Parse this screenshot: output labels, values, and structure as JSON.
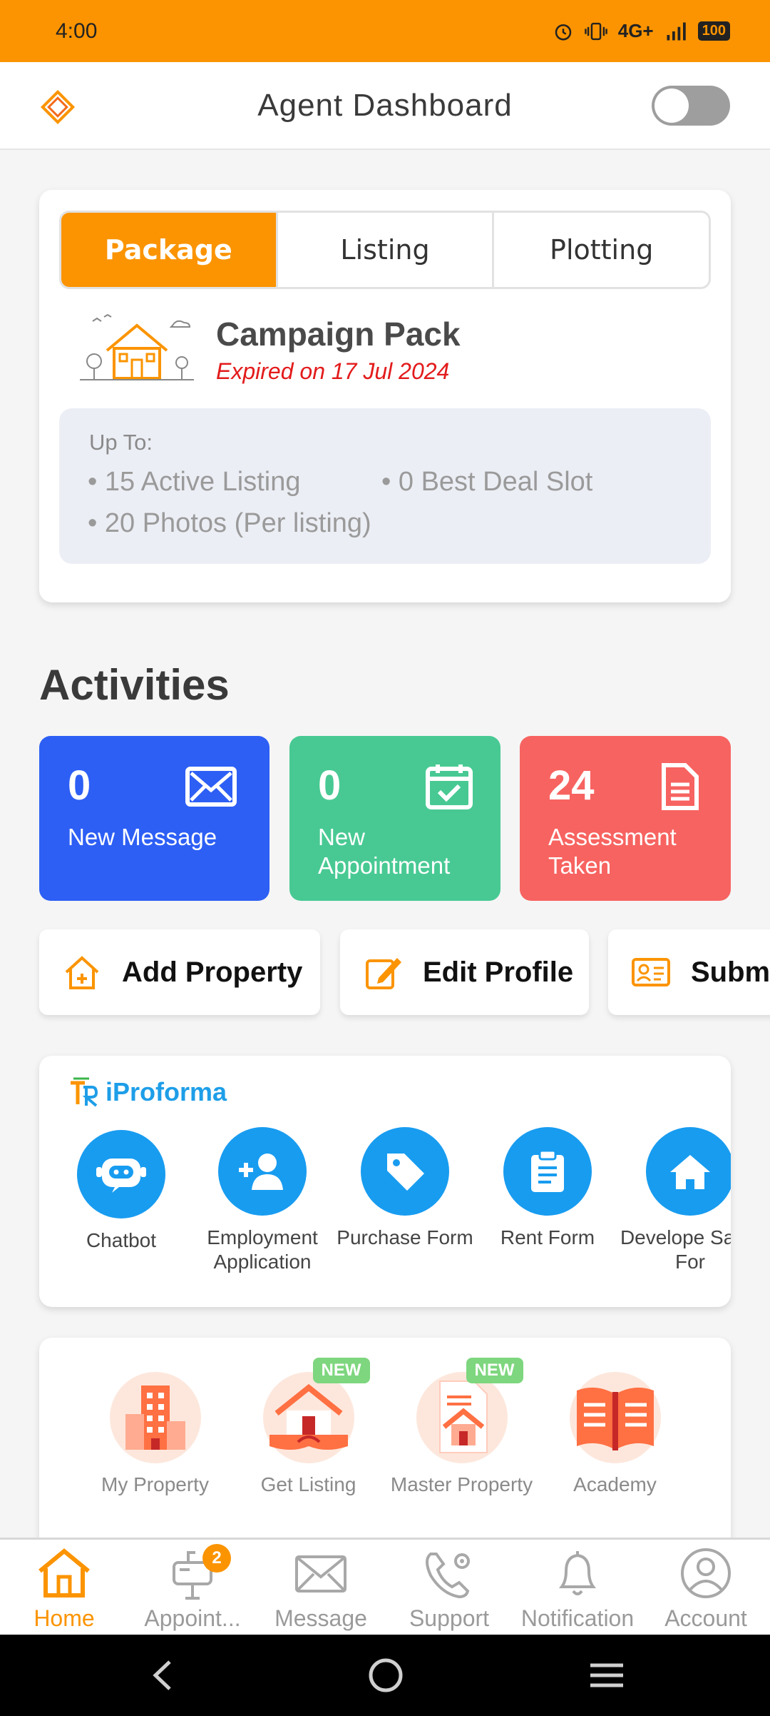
{
  "status_bar": {
    "time": "4:00",
    "network": "4G+",
    "battery": "100"
  },
  "header": {
    "title": "Agent Dashboard"
  },
  "package": {
    "tabs": [
      "Package",
      "Listing",
      "Plotting"
    ],
    "active_tab": "Package",
    "name": "Campaign Pack",
    "expiry": "Expired on 17 Jul 2024",
    "upto_label": "Up To:",
    "features": [
      "15 Active Listing",
      "0 Best Deal Slot",
      "20 Photos (Per listing)"
    ]
  },
  "activities": {
    "title": "Activities",
    "items": [
      {
        "count": "0",
        "label": "New Message",
        "color": "#2d5ff5",
        "icon": "mail-icon"
      },
      {
        "count": "0",
        "label": "New Appointment",
        "color": "#48c993",
        "icon": "calendar-check-icon"
      },
      {
        "count": "24",
        "label": "Assessment Taken",
        "color": "#f76360",
        "icon": "document-icon"
      }
    ]
  },
  "quick_actions": [
    "Add Property",
    "Edit Profile",
    "Submi"
  ],
  "iproforma": {
    "title": "iProforma",
    "items": [
      {
        "label": "Chatbot",
        "icon": "robot-icon"
      },
      {
        "label": "Employment Application",
        "icon": "add-user-icon"
      },
      {
        "label": "Purchase Form",
        "icon": "tag-icon"
      },
      {
        "label": "Rent Form",
        "icon": "clipboard-icon"
      },
      {
        "label": "Develope Sales For",
        "icon": "home-icon"
      }
    ]
  },
  "services": {
    "items": [
      {
        "label": "My Property",
        "new": false
      },
      {
        "label": "Get Listing",
        "new": true
      },
      {
        "label": "Master Property",
        "new": true
      },
      {
        "label": "Academy",
        "new": false
      }
    ],
    "new_badge": "NEW"
  },
  "bottom_nav": {
    "items": [
      {
        "label": "Home",
        "active": true
      },
      {
        "label": "Appoint...",
        "badge": "2"
      },
      {
        "label": "Message"
      },
      {
        "label": "Support"
      },
      {
        "label": "Notification"
      },
      {
        "label": "Account"
      }
    ]
  },
  "colors": {
    "accent": "#fb9400",
    "link_blue": "#1e9ee8",
    "expired_red": "#e31b1b"
  }
}
